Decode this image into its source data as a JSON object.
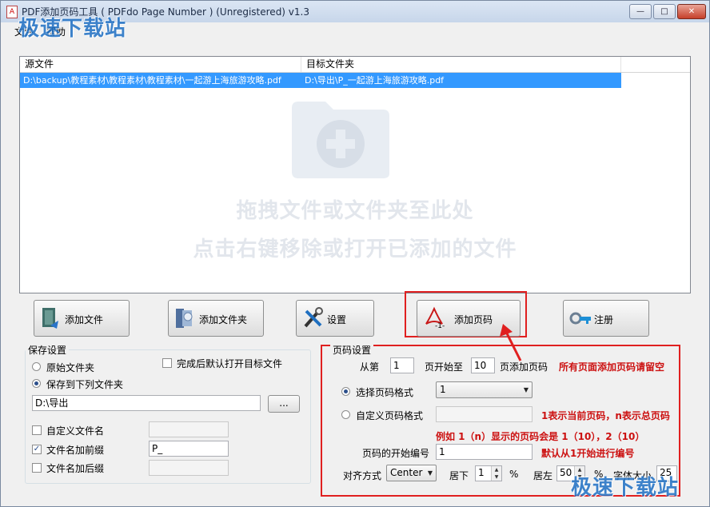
{
  "window": {
    "title": "PDF添加页码工具 ( PDFdo Page Number )  (Unregistered) v1.3",
    "minimize_glyph": "—",
    "maximize_glyph": "□",
    "close_glyph": "✕"
  },
  "menu": {
    "items": [
      "文件",
      "帮助"
    ]
  },
  "watermark": {
    "text": "极速下载站"
  },
  "file_list": {
    "columns": [
      "源文件",
      "目标文件夹"
    ],
    "rows": [
      {
        "source": "D:\\backup\\教程素材\\教程素材\\教程素材\\一起游上海旅游攻略.pdf",
        "target": "D:\\导出\\P_一起游上海旅游攻略.pdf"
      }
    ],
    "drop_hint_line1": "拖拽文件或文件夹至此处",
    "drop_hint_line2": "点击右键移除或打开已添加的文件"
  },
  "toolbar": {
    "add_file": "添加文件",
    "add_folder": "添加文件夹",
    "settings": "设置",
    "add_page_number": "添加页码",
    "register": "注册",
    "page_icon_label": "-1-"
  },
  "save_settings": {
    "title": "保存设置",
    "original_folder": "原始文件夹",
    "save_to_folder": "保存到下列文件夹",
    "open_after": "完成后默认打开目标文件",
    "folder_path": "D:\\导出",
    "browse": "...",
    "custom_name": "自定义文件名",
    "add_prefix": "文件名加前缀",
    "prefix_value": "P_",
    "add_suffix": "文件名加后缀",
    "check_mark": "✓"
  },
  "page_settings": {
    "title": "页码设置",
    "from_label": "从第",
    "from_value": "1",
    "start_to_label": "页开始至",
    "to_value": "10",
    "add_label": "页添加页码",
    "note_all": "所有页面添加页码请留空",
    "select_format": "选择页码格式",
    "format_value": "1",
    "custom_format": "自定义页码格式",
    "note_format": "1表示当前页码，n表示总页码",
    "note_example": "例如 1（n）显示的页码会是 1（10），2（10）",
    "start_number_label": "页码的开始编号",
    "start_number_value": "1",
    "note_start": "默认从1开始进行编号",
    "align_label": "对齐方式",
    "align_value": "Center",
    "bottom_label": "居下",
    "bottom_value": "1",
    "percent": "%",
    "left_label": "居左",
    "left_value": "50",
    "font_size_label": "字体大小",
    "font_size_value": "25"
  },
  "colors": {
    "selection": "#3399ff",
    "highlight": "#e02020",
    "note": "#cc1111",
    "watermark": "#1e6fc4"
  }
}
